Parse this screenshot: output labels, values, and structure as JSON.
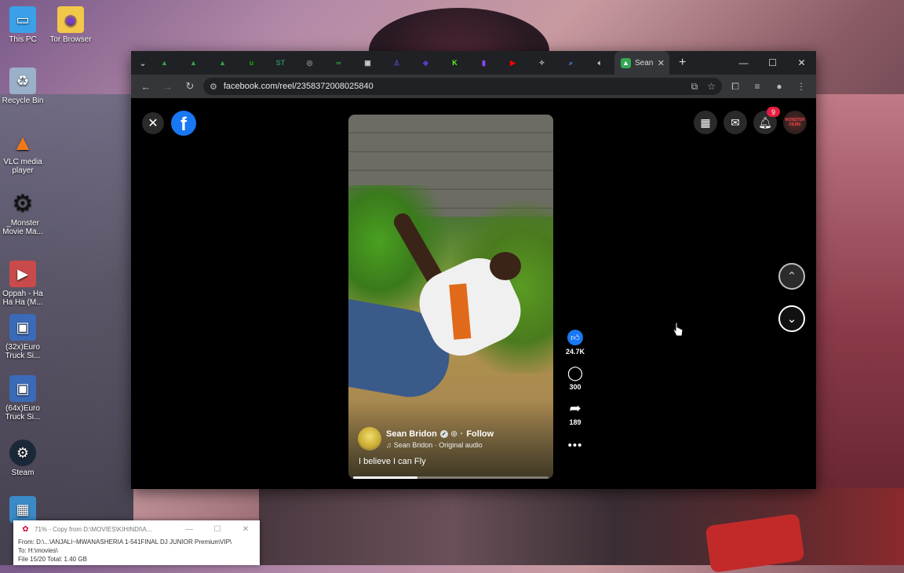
{
  "desktop": {
    "icons": [
      {
        "label": "This PC",
        "icon": "monitor-icon",
        "color": "#3aa0e8"
      },
      {
        "label": "Tor Browser",
        "icon": "folder-icon",
        "color": "#f2c84a"
      },
      {
        "label": "Recycle Bin",
        "icon": "recycle-bin-icon",
        "color": "#9ab0c8"
      },
      {
        "label": "VLC media player",
        "icon": "vlc-cone-icon",
        "color": "#f07a1a"
      },
      {
        "label": "_Monster Movie Ma...",
        "icon": "gear-icon",
        "color": "#222222"
      },
      {
        "label": "Oppah - Ha Ha Ha (M...",
        "icon": "video-file-icon",
        "color": "#c84a4a"
      },
      {
        "label": "(32x)Euro Truck Si...",
        "icon": "truck-game-icon",
        "color": "#3a6ab8"
      },
      {
        "label": "(64x)Euro Truck Si...",
        "icon": "truck-game-icon",
        "color": "#3a6ab8"
      },
      {
        "label": "Steam",
        "icon": "steam-icon",
        "color": "#1b2838"
      }
    ]
  },
  "browser": {
    "tabs": [
      {
        "icon": "google-drive-icon",
        "color": "#34a853"
      },
      {
        "icon": "google-drive-icon",
        "color": "#34a853"
      },
      {
        "icon": "google-drive-icon",
        "color": "#34a853"
      },
      {
        "icon": "upwork-icon",
        "color": "#14a800"
      },
      {
        "icon": "st-icon",
        "color": "#2a8a5a"
      },
      {
        "icon": "globe-icon",
        "color": "#888888"
      },
      {
        "icon": "link-icon",
        "color": "#3a9a3a"
      },
      {
        "icon": "image-icon",
        "color": "#cccccc"
      },
      {
        "icon": "person-icon",
        "color": "#4a4ac8"
      },
      {
        "icon": "shield-icon",
        "color": "#5a3ac8"
      },
      {
        "icon": "kick-icon",
        "color": "#53fc18"
      },
      {
        "icon": "twitch-icon",
        "color": "#9146ff"
      },
      {
        "icon": "youtube-icon",
        "color": "#ff0000"
      },
      {
        "icon": "puzzle-icon",
        "color": "#cccccc"
      },
      {
        "icon": "search-lens-icon",
        "color": "#4a8ae8"
      },
      {
        "icon": "speaker-icon",
        "color": "#cccccc"
      }
    ],
    "active_tab": {
      "label": "Sean",
      "icon": "google-drive-icon",
      "color": "#34a853"
    },
    "address": "facebook.com/reel/2358372008025840"
  },
  "facebook": {
    "notification_count": "9",
    "profile_text": "MONSTER FILMS",
    "reel": {
      "author": "Sean Bridon",
      "follow_label": "Follow",
      "audio": "Sean Bridon · Original audio",
      "caption": "I believe I can Fly",
      "progress": 0.33,
      "likes": "24.7K",
      "comments": "300",
      "shares": "189"
    }
  },
  "copy_dialog": {
    "title": "71% - Copy from D:\\MOVIES\\KIHINDI\\A...",
    "from": "From:  D:\\...\\ANJALI~MWANASHERIA 1-541FINAL DJ JUNIOR PremiumVIP\\",
    "to": "To:     H:\\movies\\",
    "files": "File 15/20  Total: 1.40 GB"
  }
}
